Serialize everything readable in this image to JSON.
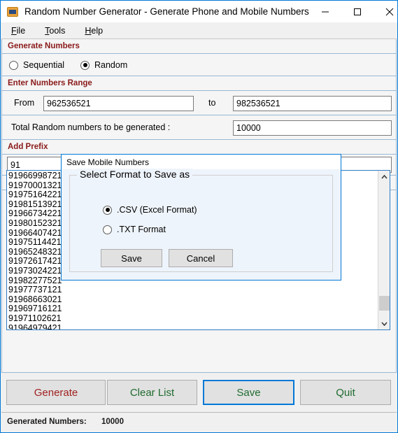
{
  "window": {
    "title": "Random Number Generator - Generate Phone and Mobile Numbers",
    "icon": "app-icon",
    "controls": {
      "minimize": "minimize-icon",
      "maximize": "maximize-icon",
      "close": "close-icon"
    }
  },
  "menubar": {
    "items": [
      {
        "label": "File",
        "mnemonic": "F"
      },
      {
        "label": "Tools",
        "mnemonic": "T"
      },
      {
        "label": "Help",
        "mnemonic": "H"
      }
    ]
  },
  "sections": {
    "generate_numbers": "Generate Numbers",
    "enter_numbers_range": "Enter Numbers Range",
    "add_prefix": "Add Prefix",
    "generated_numbers": "Generated Numbers"
  },
  "mode": {
    "sequential_label": "Sequential",
    "random_label": "Random",
    "selected": "Random"
  },
  "range": {
    "from_label": "From",
    "from_value": "962536521",
    "to_label": "to",
    "to_value": "982536521"
  },
  "total": {
    "label": "Total Random numbers to be generated :",
    "value": "10000"
  },
  "prefix": {
    "value": "91"
  },
  "generated_list": [
    "91966998721",
    "91970001321",
    "91975164221",
    "91981513921",
    "91966734221",
    "91980152321",
    "91966407421",
    "91975114421",
    "91965248321",
    "91972617421",
    "91973024221",
    "91982277521",
    "91977737121",
    "91968663021",
    "91969716121",
    "91971102621",
    "91964979421"
  ],
  "scrollbar": {
    "up_icon": "chevron-up-icon",
    "down_icon": "chevron-down-icon"
  },
  "buttons": {
    "generate": "Generate",
    "clear_list": "Clear List",
    "save": "Save",
    "quit": "Quit",
    "generate_color": "#a02020",
    "other_color": "#1f6b2f",
    "focus_color": "#0078d7"
  },
  "status": {
    "label": "Generated Numbers:",
    "value": "10000"
  },
  "dialog": {
    "title": "Save Mobile Numbers",
    "group_legend": "Select Format to Save as",
    "options": [
      {
        "label": ".CSV (Excel Format)",
        "selected": true
      },
      {
        "label": ".TXT Format",
        "selected": false
      }
    ],
    "save_label": "Save",
    "cancel_label": "Cancel"
  }
}
